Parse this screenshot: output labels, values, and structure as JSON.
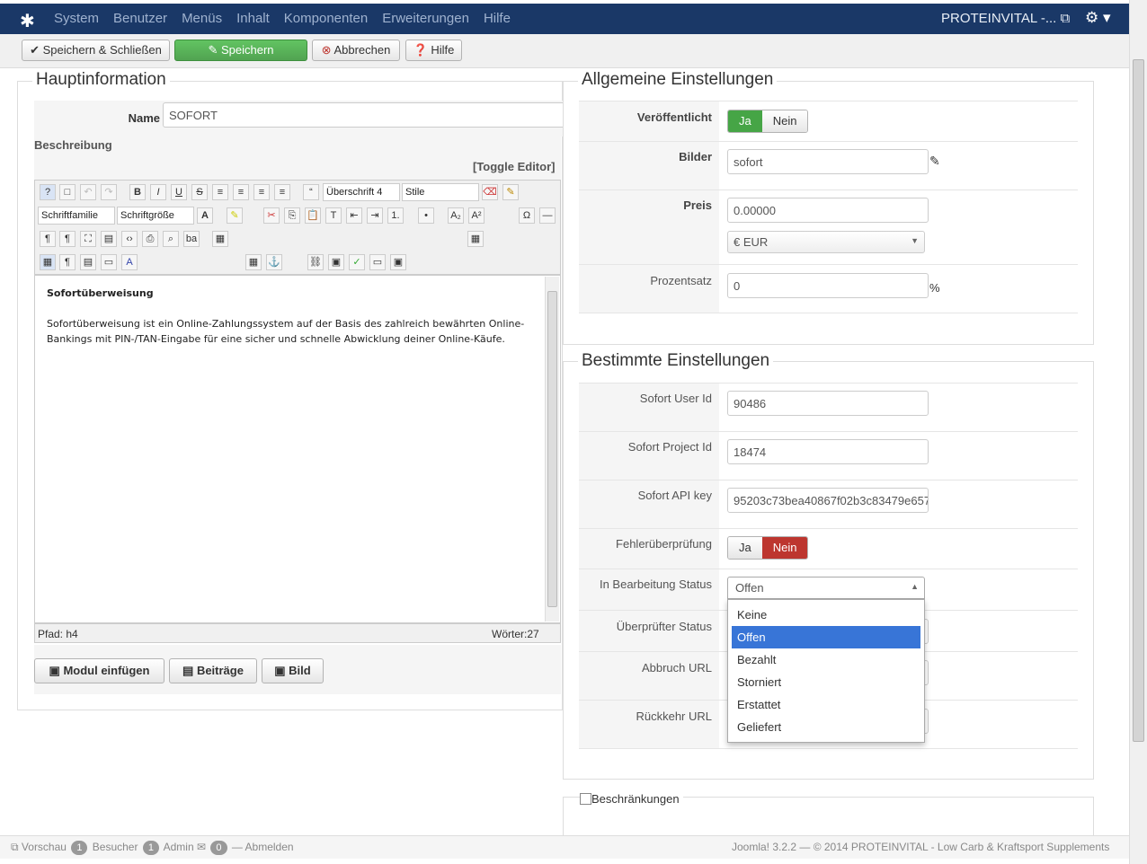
{
  "topbar": {
    "menu": [
      "System",
      "Benutzer",
      "Menüs",
      "Inhalt",
      "Komponenten",
      "Erweiterungen",
      "Hilfe"
    ],
    "site_name": "PROTEINVITAL -..."
  },
  "toolbar": {
    "save_close": "Speichern & Schließen",
    "save": "Speichern",
    "cancel": "Abbrechen",
    "help": "Hilfe"
  },
  "main": {
    "legend": "Hauptinformation",
    "name_label": "Name",
    "name_value": "SOFORT",
    "description_label": "Beschreibung",
    "toggle_editor": "[Toggle Editor]",
    "editor": {
      "format_select": "Überschrift 4",
      "style_select": "Stile",
      "font_family": "Schriftfamilie",
      "font_size": "Schriftgröße",
      "heading": "Sofortüberweisung",
      "body": "Sofortüberweisung ist ein Online-Zahlungssystem auf der Basis des zahlreich bewährten Online-Bankings mit PIN-/TAN-Eingabe für eine sicher und schnelle Abwicklung deiner Online-Käufe.",
      "path": "Pfad:  h4",
      "words": "Wörter:27"
    },
    "buttons": {
      "module": "Modul einfügen",
      "articles": "Beiträge",
      "image": "Bild"
    }
  },
  "general": {
    "legend": "Allgemeine Einstellungen",
    "published_label": "Veröffentlicht",
    "yes": "Ja",
    "no": "Nein",
    "images_label": "Bilder",
    "images_value": "sofort",
    "price_label": "Preis",
    "price_value": "0.00000",
    "currency_value": "€ EUR",
    "percent_label": "Prozentsatz",
    "percent_value": "0",
    "percent_unit": "%"
  },
  "specific": {
    "legend": "Bestimmte Einstellungen",
    "user_id_label": "Sofort User Id",
    "user_id_value": "90486",
    "project_id_label": "Sofort Project Id",
    "project_id_value": "18474",
    "api_key_label": "Sofort API key",
    "api_key_value": "95203c73bea40867f02b3c83479e657",
    "error_check_label": "Fehlerüberprüfung",
    "yes": "Ja",
    "no": "Nein",
    "processing_label": "In Bearbeitung Status",
    "processing_value": "Offen",
    "checker_label": "Überprüfter Status",
    "abort_label": "Abbruch URL",
    "return_label": "Rückkehr URL",
    "options": [
      "Keine",
      "Offen",
      "Bezahlt",
      "Storniert",
      "Erstattet",
      "Geliefert"
    ]
  },
  "restrictions": {
    "legend": "Beschränkungen"
  },
  "status": {
    "preview": "Vorschau",
    "visitors_count": "1",
    "visitors": "Besucher",
    "admin_count": "1",
    "admin": "Admin",
    "messages_count": "0",
    "logout": "Abmelden",
    "copyright": "Joomla! 3.2.2  —  © 2014 PROTEINVITAL - Low Carb & Kraftsport Supplements"
  }
}
